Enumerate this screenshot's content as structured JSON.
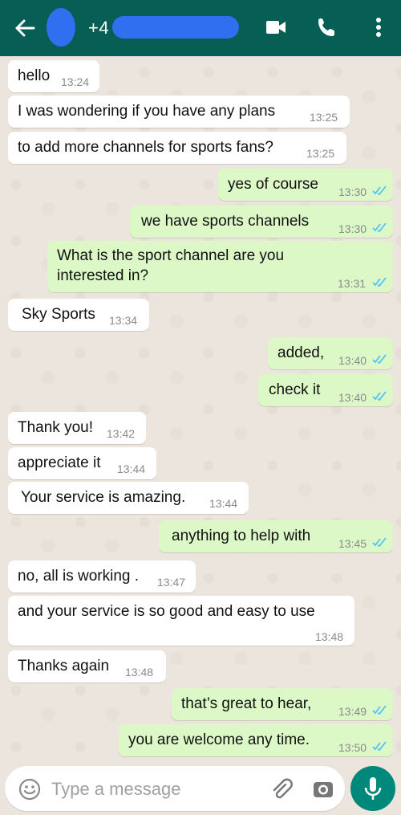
{
  "header": {
    "contact_prefix": "+4",
    "colors": {
      "bar": "#075e54",
      "redaction": "#2f6ff0"
    },
    "icons": [
      "back-arrow-icon",
      "avatar-icon",
      "video-call-icon",
      "phone-icon",
      "more-vert-icon"
    ]
  },
  "messages": [
    {
      "dir": "in",
      "text": "hello",
      "time": "13:24"
    },
    {
      "dir": "in",
      "text": "I was wondering if you have any plans",
      "time": "13:25"
    },
    {
      "dir": "in",
      "text": "to add more channels for sports fans?",
      "time": "13:25"
    },
    {
      "dir": "out",
      "text": "yes of course",
      "time": "13:30",
      "read": true
    },
    {
      "dir": "out",
      "text": "we have sports channels",
      "time": "13:30",
      "read": true
    },
    {
      "dir": "out",
      "text": "What is the sport channel are you interested in?",
      "line1": "What is the sport channel are you",
      "line2": "interested in?",
      "time": "13:31",
      "read": true
    },
    {
      "dir": "in",
      "text": "Sky Sports",
      "time": "13:34"
    },
    {
      "dir": "out",
      "text": "added,",
      "time": "13:40",
      "read": true
    },
    {
      "dir": "out",
      "text": "check it",
      "time": "13:40",
      "read": true
    },
    {
      "dir": "in",
      "text": "Thank you!",
      "time": "13:42"
    },
    {
      "dir": "in",
      "text": "appreciate it",
      "time": "13:44"
    },
    {
      "dir": "in",
      "text": "Your service is amazing.",
      "time": "13:44"
    },
    {
      "dir": "out",
      "text": "anything to help with",
      "time": "13:45",
      "read": true
    },
    {
      "dir": "in",
      "text": "no, all is working .",
      "time": "13:47"
    },
    {
      "dir": "in",
      "text": "and your service is so good and easy to use",
      "time": "13:48"
    },
    {
      "dir": "in",
      "text": "Thanks again",
      "time": "13:48"
    },
    {
      "dir": "out",
      "text": "that’s great to hear,",
      "time": "13:49",
      "read": true
    },
    {
      "dir": "out",
      "text": "you are welcome any time.",
      "time": "13:50",
      "read": true
    }
  ],
  "composer": {
    "placeholder": "Type a message",
    "icons": [
      "emoji-icon",
      "attach-icon",
      "camera-icon",
      "mic-icon"
    ],
    "send_color": "#00897b"
  },
  "colors": {
    "incoming": "#ffffff",
    "outgoing": "#dcf8c6",
    "read_tick": "#4fc3f7",
    "wallpaper": "#ece5dd"
  }
}
